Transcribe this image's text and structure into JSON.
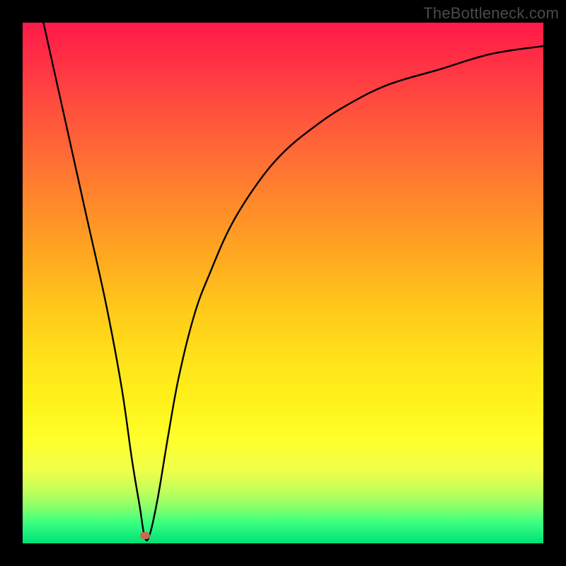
{
  "watermark": "TheBottleneck.com",
  "chart_data": {
    "type": "line",
    "title": "",
    "xlabel": "",
    "ylabel": "",
    "xlim": [
      0,
      100
    ],
    "ylim": [
      0,
      100
    ],
    "marker": {
      "x": 23.5,
      "y": 1.5,
      "color": "#c86a52"
    },
    "series": [
      {
        "name": "curve",
        "x": [
          4,
          8,
          12,
          16,
          19,
          21,
          22.5,
          23.5,
          24.5,
          26,
          28,
          30,
          33,
          36,
          40,
          45,
          50,
          56,
          62,
          70,
          80,
          90,
          100
        ],
        "y": [
          100,
          82,
          64,
          46,
          30,
          16,
          7,
          1,
          2,
          9,
          21,
          32,
          44,
          52,
          61,
          69,
          75,
          80,
          84,
          88,
          91,
          94,
          95.5
        ]
      }
    ],
    "gradient_stops": [
      {
        "pos": 0,
        "color": "#ff1a4a"
      },
      {
        "pos": 50,
        "color": "#ffc91a"
      },
      {
        "pos": 80,
        "color": "#ffff2a"
      },
      {
        "pos": 100,
        "color": "#00e078"
      }
    ]
  }
}
